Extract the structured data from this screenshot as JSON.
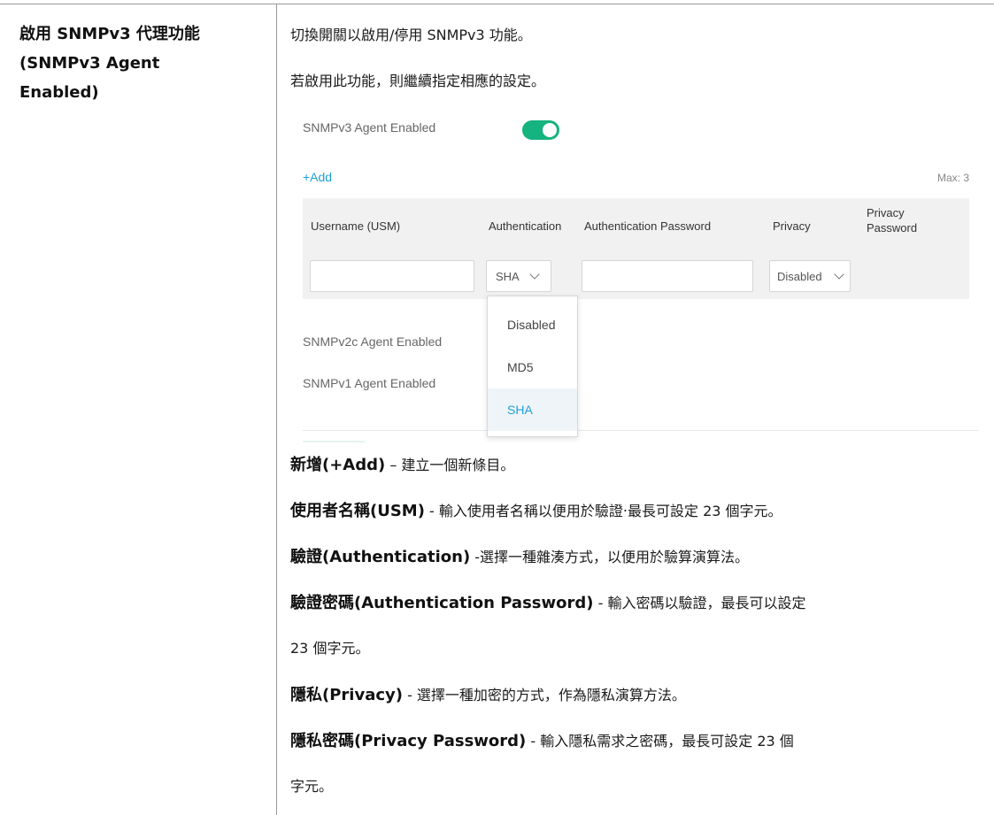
{
  "left_title": {
    "line1": "啟用 SNMPv3 代理功能",
    "line2": "(SNMPv3 Agent",
    "line3": "Enabled)"
  },
  "description": {
    "line1": "切換開關以啟用/停用 SNMPv3 功能。",
    "line2": "若啟用此功能，則繼續指定相應的設定。"
  },
  "ui": {
    "snmpv3_label": "SNMPv3 Agent Enabled",
    "snmpv3_enabled": true,
    "add_label": "+Add",
    "max_label": "Max: 3",
    "columns": {
      "username": "Username (USM)",
      "authentication": "Authentication",
      "auth_password": "Authentication Password",
      "privacy": "Privacy",
      "privacy_password_line1": "Privacy",
      "privacy_password_line2": "Password"
    },
    "row": {
      "username_value": "",
      "authentication_value": "SHA",
      "auth_password_value": "",
      "privacy_value": "Disabled"
    },
    "auth_options": [
      "Disabled",
      "MD5",
      "SHA"
    ],
    "auth_selected": "SHA",
    "snmpv2c_label": "SNMPv2c Agent Enabled",
    "snmpv1_label": "SNMPv1 Agent Enabled",
    "colors": {
      "toggle_on": "#14b37f",
      "link": "#1da0d8",
      "table_bg": "#f1f1f1"
    }
  },
  "definitions": [
    {
      "term": "新增(+Add)",
      "text": " – 建立一個新條目。"
    },
    {
      "term": "使用者名稱(USM)",
      "text": " - 輸入使用者名稱以便用於驗證‧最長可設定 23 個字元。"
    },
    {
      "term": "驗證(Authentication)",
      "text": " -選擇一種雜湊方式，以便用於驗算演算法。"
    },
    {
      "term": "驗證密碼(Authentication Password)",
      "text": " - 輸入密碼以驗證，最長可以設定",
      "continuation": "23 個字元。"
    },
    {
      "term": "隱私(Privacy)",
      "text": " - 選擇一種加密的方式，作為隱私演算方法。"
    },
    {
      "term": "隱私密碼(Privacy Password)",
      "text": " - 輸入隱私需求之密碼，最長可設定 23 個",
      "continuation": "字元。"
    }
  ]
}
